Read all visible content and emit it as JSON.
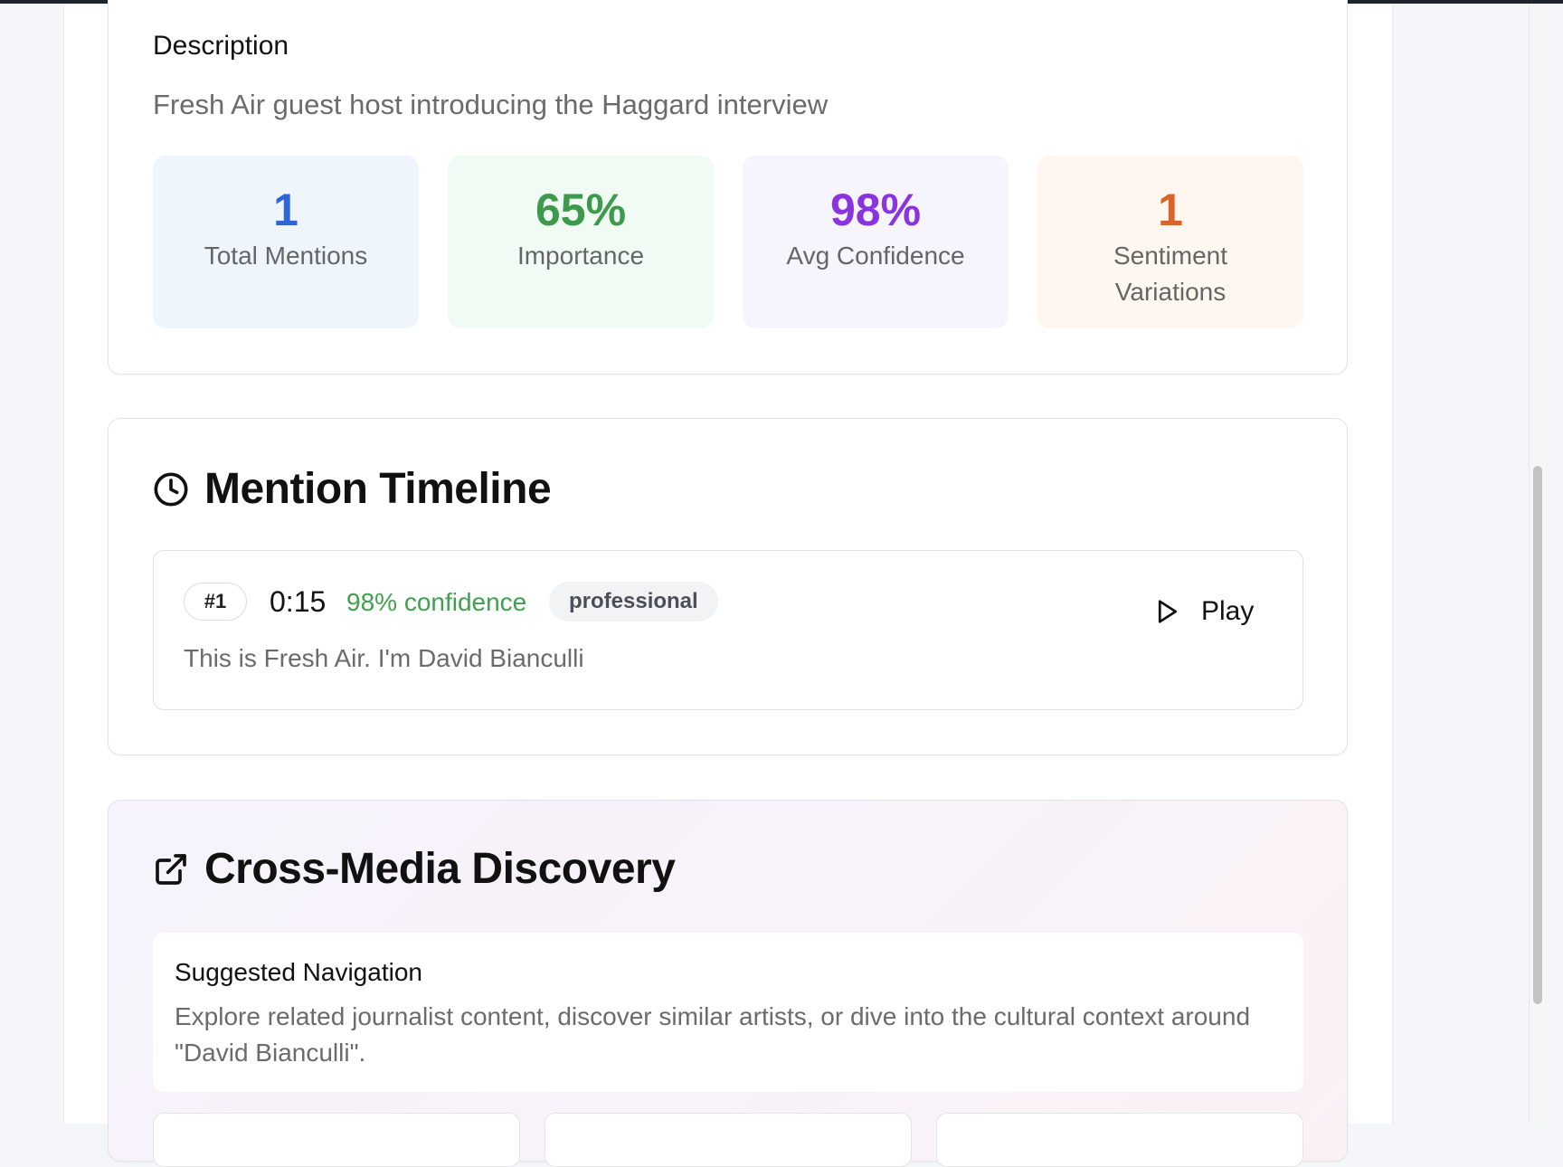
{
  "description": {
    "label": "Description",
    "text": "Fresh Air guest host introducing the Haggard interview"
  },
  "stats": [
    {
      "value": "1",
      "label": "Total Mentions",
      "color": "#2e66d8"
    },
    {
      "value": "65%",
      "label": "Importance",
      "color": "#3d9a4d"
    },
    {
      "value": "98%",
      "label": "Avg Confidence",
      "color": "#8a34e0"
    },
    {
      "value": "1",
      "label": "Sentiment Variations",
      "color": "#d9652b"
    }
  ],
  "timeline": {
    "title": "Mention Timeline",
    "icon": "clock-icon",
    "mentions": [
      {
        "number": "#1",
        "time": "0:15",
        "confidence": "98% confidence",
        "tag": "professional",
        "text": "This is Fresh Air. I'm David Bianculli",
        "play_label": "Play",
        "play_icon": "play-icon"
      }
    ]
  },
  "cross_media": {
    "title": "Cross-Media Discovery",
    "icon": "external-link-icon",
    "suggested": {
      "title": "Suggested Navigation",
      "text": "Explore related journalist content, discover similar artists, or dive into the cultural context around \"David Bianculli\"."
    }
  }
}
